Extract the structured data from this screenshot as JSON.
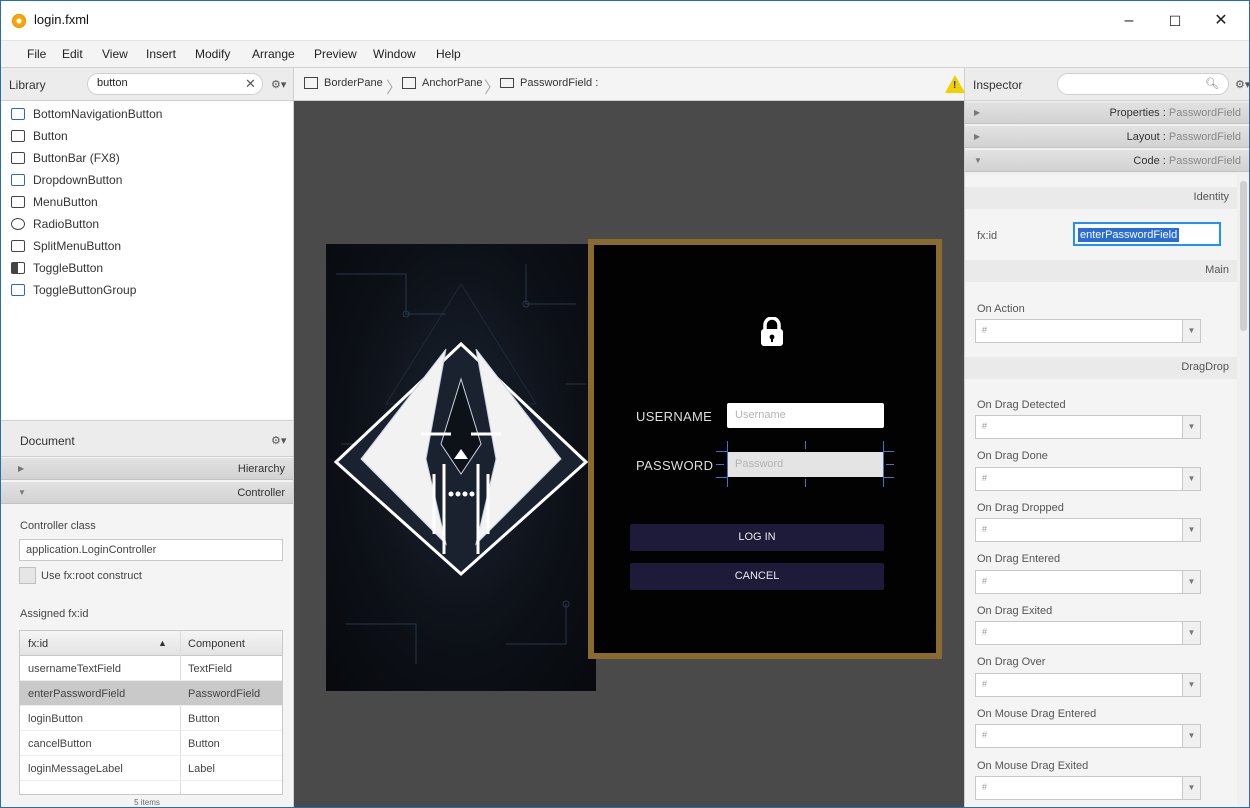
{
  "window": {
    "title": "login.fxml",
    "minimize": "–",
    "maximize": "☐",
    "close": "✕"
  },
  "menu": [
    "File",
    "Edit",
    "View",
    "Insert",
    "Modify",
    "Arrange",
    "Preview",
    "Window",
    "Help"
  ],
  "library": {
    "title": "Library",
    "search_value": "button",
    "items": [
      "BottomNavigationButton",
      "Button",
      "ButtonBar  (FX8)",
      "DropdownButton",
      "MenuButton",
      "RadioButton",
      "SplitMenuButton",
      "ToggleButton",
      "ToggleButtonGroup"
    ]
  },
  "document": {
    "title": "Document",
    "hierarchy": "Hierarchy",
    "controller": "Controller",
    "controller_class_label": "Controller class",
    "controller_class_value": "application.LoginController",
    "fxroot_label": "Use fx:root construct",
    "assigned_label": "Assigned fx:id",
    "table_headers": [
      "fx:id",
      "Component"
    ],
    "rows": [
      {
        "fxid": "usernameTextField",
        "component": "TextField"
      },
      {
        "fxid": "enterPasswordField",
        "component": "PasswordField"
      },
      {
        "fxid": "loginButton",
        "component": "Button"
      },
      {
        "fxid": "cancelButton",
        "component": "Button"
      },
      {
        "fxid": "loginMessageLabel",
        "component": "Label"
      }
    ],
    "items_count": "5 items"
  },
  "breadcrumb": [
    "BorderPane",
    "AnchorPane",
    "PasswordField :"
  ],
  "login_form": {
    "username_label": "USERNAME",
    "username_placeholder": "Username",
    "password_label": "PASSWORD",
    "password_placeholder": "Password",
    "login_button": "LOG IN",
    "cancel_button": "CANCEL"
  },
  "inspector": {
    "title": "Inspector",
    "sections": [
      {
        "name": "Properties",
        "target": "PasswordField"
      },
      {
        "name": "Layout",
        "target": "PasswordField"
      },
      {
        "name": "Code",
        "target": "PasswordField"
      }
    ],
    "identity": "Identity",
    "fxid_label": "fx:id",
    "fxid_value": "enterPasswordField",
    "main": "Main",
    "on_action": "On Action",
    "dragdrop": "DragDrop",
    "events": [
      "On Drag Detected",
      "On Drag Done",
      "On Drag Dropped",
      "On Drag Entered",
      "On Drag Exited",
      "On Drag Over",
      "On Mouse Drag Entered",
      "On Mouse Drag Exited"
    ],
    "hash": "#"
  },
  "colors": {
    "frame_gold": "#8a6a2e",
    "button_navy": "#1e1b3a",
    "selection_blue": "#2a6cd6",
    "warning_yellow": "#f0d000"
  }
}
